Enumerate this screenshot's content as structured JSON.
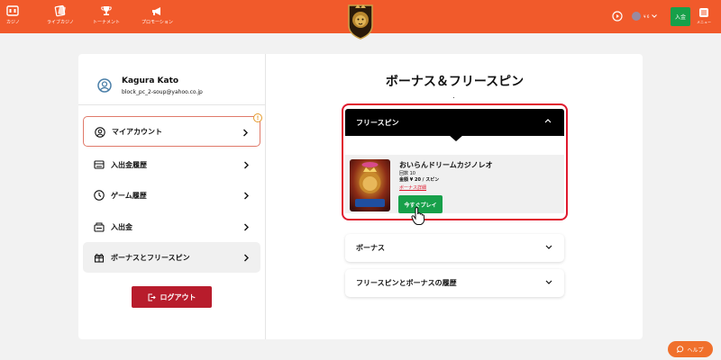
{
  "header": {
    "nav": [
      {
        "label": "カジノ",
        "icon": "casino-icon"
      },
      {
        "label": "ライブカジノ",
        "icon": "live-casino-icon"
      },
      {
        "label": "トーナメント",
        "icon": "trophy-icon"
      },
      {
        "label": "プロモーション",
        "icon": "megaphone-icon"
      }
    ],
    "balance_label": "¥ 6",
    "deposit_label": "入金",
    "menu_label": "メニュー",
    "accent": "#f15a2b"
  },
  "profile": {
    "name": "Kagura Kato",
    "email": "block_pc_2-soup@yahoo.co.jp"
  },
  "sidebar": {
    "items": [
      {
        "label": "マイアカウント",
        "icon": "user-icon"
      },
      {
        "label": "入出金履歴",
        "icon": "wallet-icon"
      },
      {
        "label": "ゲーム履歴",
        "icon": "clock-icon"
      },
      {
        "label": "入出金",
        "icon": "cashier-icon"
      },
      {
        "label": "ボーナスとフリースピン",
        "icon": "gift-icon"
      }
    ],
    "notification": "!",
    "logout_label": "ログアウト"
  },
  "main": {
    "title": "ボーナス＆フリースピン",
    "freespins": {
      "header": "フリースピン",
      "game_name": "おいらんドリームカジノレオ",
      "count": "回数 10",
      "amount": "金額 ¥ 20 / スピン",
      "details_link": "ボーナス詳細",
      "play_label": "今すぐプレイ"
    },
    "accordions": [
      {
        "label": "ボーナス"
      },
      {
        "label": "フリースピンとボーナスの履歴"
      }
    ]
  },
  "help_label": "ヘルプ",
  "colors": {
    "play_green": "#17a04a",
    "logout_red": "#b81c2c",
    "highlight_red": "#e0192e"
  }
}
